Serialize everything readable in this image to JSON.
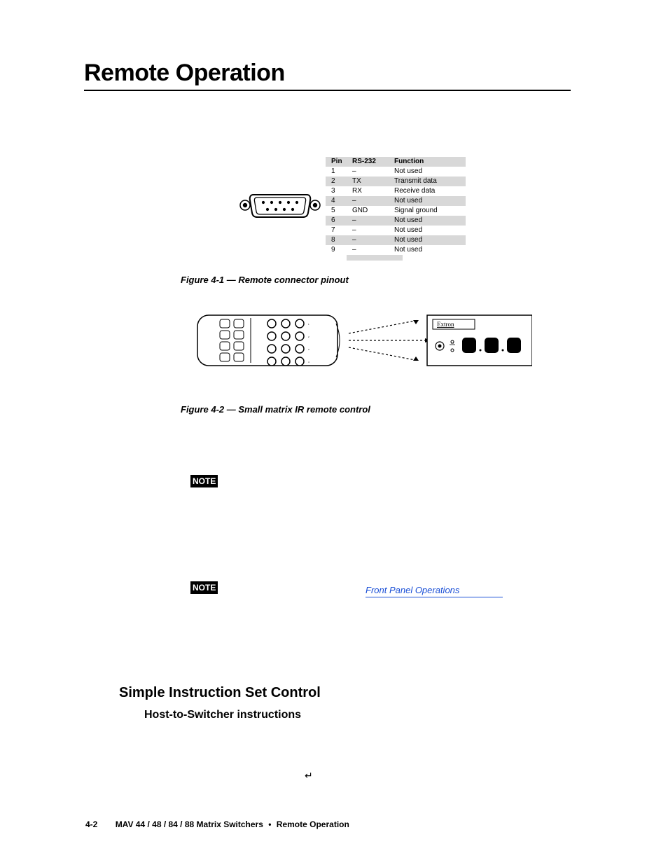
{
  "title": "Remote Operation",
  "pinout": {
    "headers": {
      "pin": "Pin",
      "rs232": "RS-232",
      "func": "Function"
    },
    "rows": [
      {
        "pin": "1",
        "rs232": "–",
        "func": "Not used"
      },
      {
        "pin": "2",
        "rs232": "TX",
        "func": "Transmit data"
      },
      {
        "pin": "3",
        "rs232": "RX",
        "func": "Receive data"
      },
      {
        "pin": "4",
        "rs232": "–",
        "func": "Not used"
      },
      {
        "pin": "5",
        "rs232": "GND",
        "func": "Signal ground"
      },
      {
        "pin": "6",
        "rs232": "–",
        "func": "Not used"
      },
      {
        "pin": "7",
        "rs232": "–",
        "func": "Not used"
      },
      {
        "pin": "8",
        "rs232": "–",
        "func": "Not used"
      },
      {
        "pin": "9",
        "rs232": "–",
        "func": "Not used"
      }
    ]
  },
  "captions": {
    "fig1": "Figure 4-1 — Remote connector pinout",
    "fig2": "Figure 4-2 — Small matrix IR remote control"
  },
  "panelLabel": "Extron",
  "notes": {
    "n1": "NOTE",
    "n2": "NOTE",
    "link": "Front Panel Operations"
  },
  "sections": {
    "sis": "Simple Instruction Set Control",
    "host": "Host-to-Switcher instructions"
  },
  "enterSym": "↵",
  "footer": {
    "page": "4-2",
    "doc": "MAV 44 / 48 / 84 / 88 Matrix Switchers",
    "sect": "Remote Operation"
  }
}
